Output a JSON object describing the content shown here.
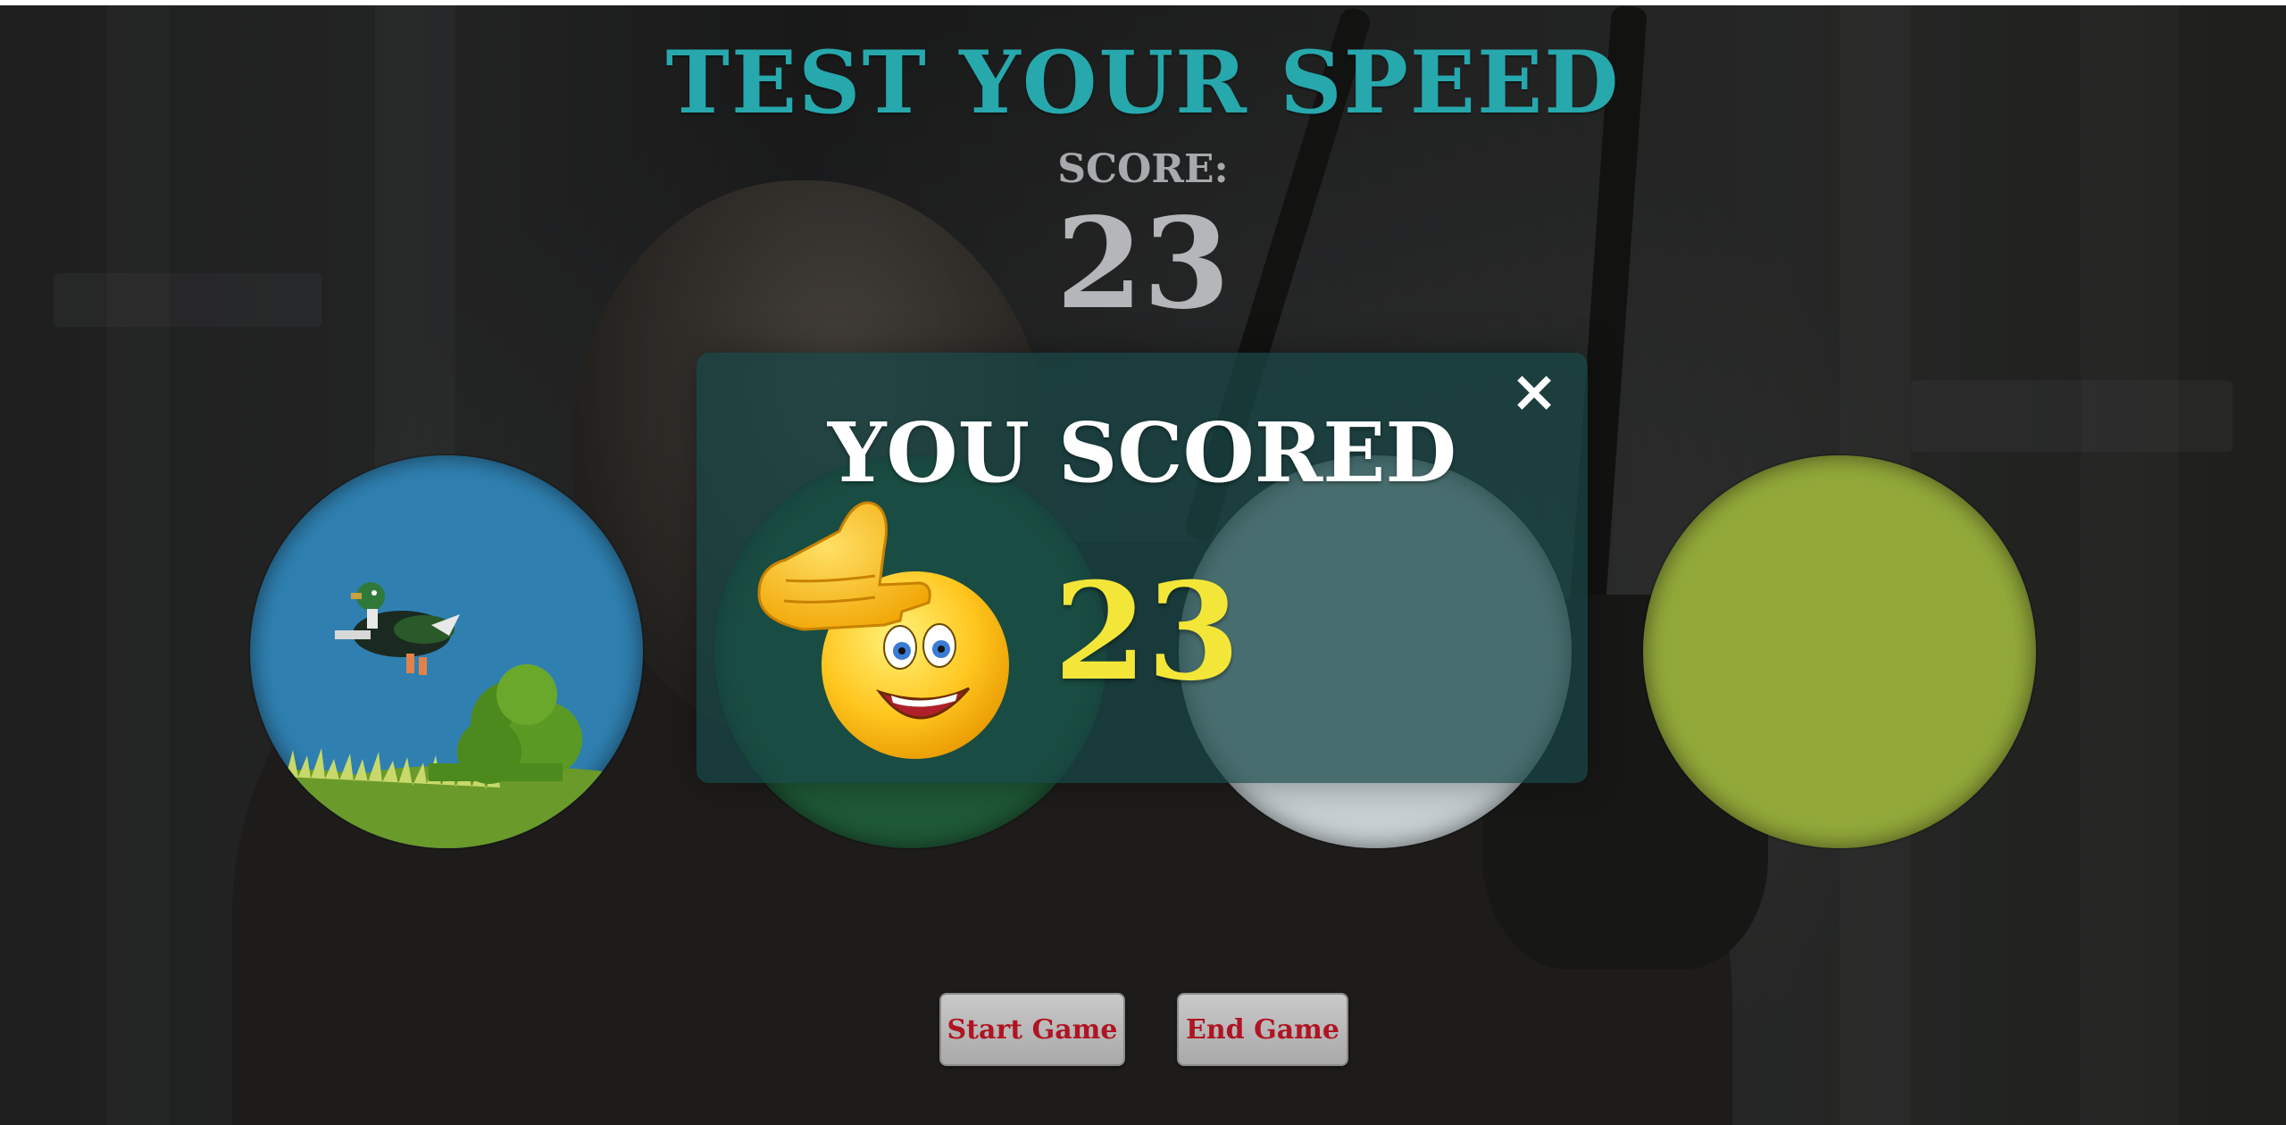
{
  "header": {
    "title": "TEST YOUR SPEED",
    "score_label": "SCORE:",
    "score_value": "23"
  },
  "circles": [
    {
      "name": "circle-duck",
      "image": "pixel-duck-flying",
      "color": "#2f80b1"
    },
    {
      "name": "circle-green",
      "color": "#1f5a37"
    },
    {
      "name": "circle-pink",
      "color": "#c7d0d3"
    },
    {
      "name": "circle-olive",
      "color": "#92a93a"
    }
  ],
  "modal": {
    "title": "YOU SCORED",
    "score": "23",
    "close_icon": "×",
    "emoji": "thumbs-up-smiley-icon"
  },
  "controls": {
    "start_label": "Start Game",
    "end_label": "End Game"
  },
  "colors": {
    "title": "#26a8ad",
    "modal_score": "#f3e638",
    "button_text": "#b01422"
  }
}
